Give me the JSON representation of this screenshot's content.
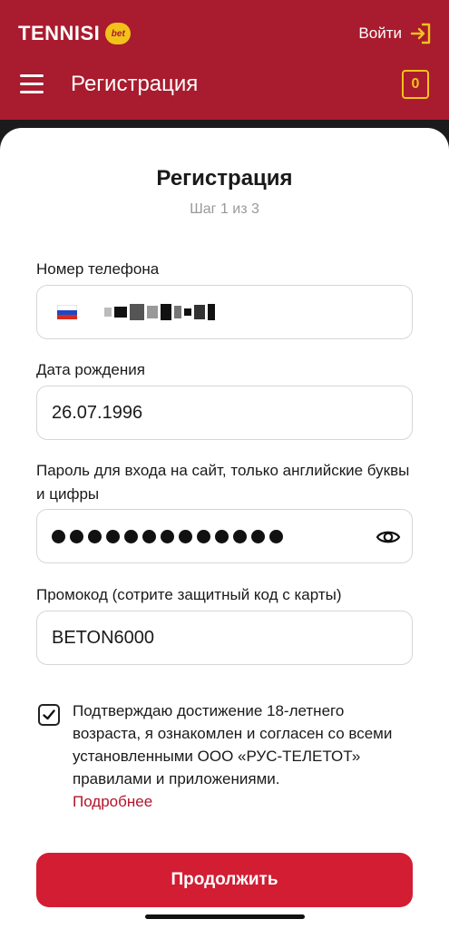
{
  "header": {
    "logo_text": "TENNISI",
    "logo_badge": "bet",
    "login_label": "Войти",
    "page_title": "Регистрация",
    "coupon_count": "0"
  },
  "form": {
    "title": "Регистрация",
    "step": "Шаг 1 из 3",
    "phone_label": "Номер телефона",
    "birth_label": "Дата рождения",
    "birth_value": "26.07.1996",
    "password_label": "Пароль для входа на сайт, только английские буквы и цифры",
    "password_dot_count": 13,
    "promo_label": "Промокод (сотрите защитный код с карты)",
    "promo_value": "BETON6000"
  },
  "consent": {
    "checked": true,
    "text": "Подтверждаю достижение 18-летнего возраста, я ознакомлен и согласен со всеми установленными ООО «РУС-ТЕЛЕТОТ» правилами и приложениями.",
    "more_link": "Подробнее"
  },
  "actions": {
    "continue_label": "Продолжить"
  },
  "colors": {
    "brand": "#a91b2e",
    "button": "#d21d33",
    "accent": "#f2c21b",
    "link": "#b3142b"
  },
  "icons": [
    "login-icon",
    "menu-icon",
    "coupon-icon",
    "russia-flag-icon",
    "eye-icon",
    "checkmark-icon"
  ]
}
